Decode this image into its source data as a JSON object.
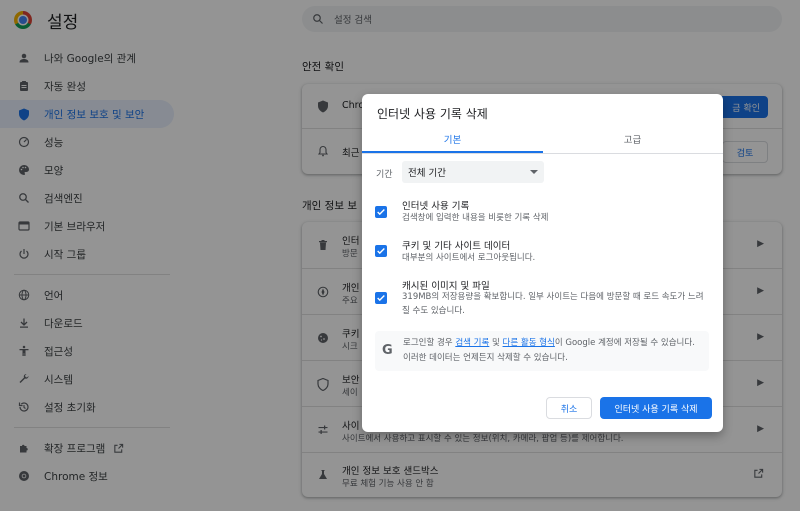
{
  "app": {
    "title": "설정"
  },
  "search": {
    "placeholder": "설정 검색"
  },
  "sidebar": {
    "items": [
      {
        "label": "나와 Google의 관계",
        "icon": "person-icon"
      },
      {
        "label": "자동 완성",
        "icon": "clipboard-icon"
      },
      {
        "label": "개인 정보 보호 및 보안",
        "icon": "shield-icon",
        "active": true
      },
      {
        "label": "성능",
        "icon": "speedometer-icon"
      },
      {
        "label": "모양",
        "icon": "palette-icon"
      },
      {
        "label": "검색엔진",
        "icon": "search-icon"
      },
      {
        "label": "기본 브라우저",
        "icon": "browser-icon"
      },
      {
        "label": "시작 그룹",
        "icon": "power-icon"
      },
      {
        "label": "언어",
        "icon": "globe-icon"
      },
      {
        "label": "다운로드",
        "icon": "download-icon"
      },
      {
        "label": "접근성",
        "icon": "accessibility-icon"
      },
      {
        "label": "시스템",
        "icon": "wrench-icon"
      },
      {
        "label": "설정 초기화",
        "icon": "history-icon"
      }
    ],
    "extensions_label": "확장 프로그램",
    "about_label": "Chrome 정보"
  },
  "main": {
    "safety_check_title": "안전 확인",
    "safety_row1_title": "Chro",
    "safety_row1_button": "금 확인",
    "safety_row2_title": "최근",
    "safety_row2_button": "검토",
    "privacy_section_title": "개인 정보 보",
    "privacy_rows": [
      {
        "title": "인터",
        "sub": "방문",
        "icon": "trash-icon"
      },
      {
        "title": "개인",
        "sub": "주요",
        "icon": "compass-icon"
      },
      {
        "title": "쿠키",
        "sub": "시크",
        "icon": "cookie-icon"
      },
      {
        "title": "보안",
        "sub": "세이",
        "icon": "shield-icon"
      },
      {
        "title": "사이",
        "sub": "사이트에서 사용하고 표시할 수 있는 정보(위치, 카메라, 팝업 등)를 제어합니다.",
        "icon": "sliders-icon"
      }
    ],
    "sandbox_title": "개인 정보 보호 샌드박스",
    "sandbox_sub": "무료 체험 기능 사용 안 함"
  },
  "dialog": {
    "title": "인터넷 사용 기록 삭제",
    "tabs": [
      {
        "label": "기본",
        "active": true
      },
      {
        "label": "고급",
        "active": false
      }
    ],
    "period_label": "기간",
    "period_value": "전체 기간",
    "options": [
      {
        "title": "인터넷 사용 기록",
        "desc": "검색창에 입력한 내용을 비롯한 기록 삭제",
        "checked": true
      },
      {
        "title": "쿠키 및 기타 사이트 데이터",
        "desc": "대부분의 사이트에서 로그아웃됩니다.",
        "checked": true
      },
      {
        "title": "캐시된 이미지 및 파일",
        "desc": "319MB의 저장용량을 확보합니다. 일부 사이트는 다음에 방문할 때 로드 속도가 느려질 수도 있습니다.",
        "checked": true
      }
    ],
    "info": {
      "pre": "로그인할 경우 ",
      "link1": "검색 기록",
      "mid": " 및 ",
      "link2": "다른 활동 형식",
      "post": "이 Google 계정에 저장될 수 있습니다. 이러한 데이터는 언제든지 삭제할 수 있습니다."
    },
    "cancel_label": "취소",
    "confirm_label": "인터넷 사용 기록 삭제"
  },
  "colors": {
    "accent": "#1a73e8",
    "active_nav_bg": "#e8f0fe",
    "scrim": "rgba(0,0,0,0.42)"
  }
}
